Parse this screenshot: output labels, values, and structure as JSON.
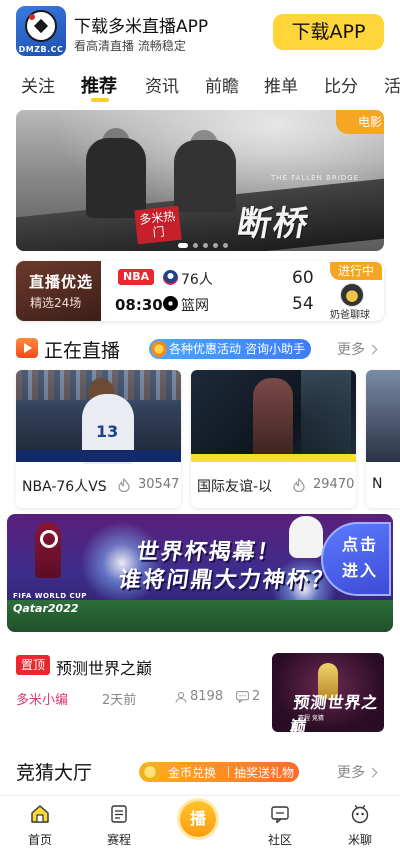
{
  "download_bar": {
    "logo_text": "DMZB.CC",
    "title": "下载多米直播APP",
    "subtitle": "看高清直播 流畅稳定",
    "button_label": "下载APP"
  },
  "tabs": [
    {
      "label": "关注"
    },
    {
      "label": "推荐"
    },
    {
      "label": "资讯"
    },
    {
      "label": "前瞻"
    },
    {
      "label": "推单"
    },
    {
      "label": "比分"
    },
    {
      "label": "活"
    }
  ],
  "hero": {
    "tag_label": "电影",
    "title_calligraphy": "断桥",
    "title_english": "THE FALLEN BRIDGE",
    "stamp_text": "多米热门",
    "slide_count": 5,
    "active_slide": 1
  },
  "match_card": {
    "pick_title": "直播优选",
    "pick_subtitle": "精选24场",
    "league": "NBA",
    "time": "08:30",
    "home_team": "76人",
    "away_team": "篮网",
    "home_score": "60",
    "away_score": "54",
    "status": "进行中",
    "anchor_name": "奶爸聊球"
  },
  "live_section": {
    "title": "正在直播",
    "promo_left": "各种优惠活动",
    "promo_right": "咨询小助手",
    "more_label": "更多"
  },
  "live_cards": [
    {
      "title": "NBA-76人VS",
      "heat": "30547",
      "jersey": "13"
    },
    {
      "title": "国际友谊-以",
      "heat": "29470"
    },
    {
      "title": "N",
      "heat": ""
    }
  ],
  "world_cup_banner": {
    "line1": "世界杯揭幕！",
    "line2": "谁将问鼎大力神杯？",
    "cup_name": "FIFA WORLD CUP",
    "cup_year": "Qatar2022",
    "cta": "点击进入"
  },
  "article": {
    "badge": "置顶",
    "title": "预测世界之巅",
    "author": "多米小编",
    "time": "2天前",
    "views": "8198",
    "comments": "2",
    "thumb_title": "预测世界之巅",
    "thumb_sub": "赛程  竞猜"
  },
  "contest_section": {
    "title": "竞猜大厅",
    "promo_left": "金币兑换",
    "promo_right": "抽奖送礼物",
    "more_label": "更多"
  },
  "bottom_nav": [
    {
      "label": "首页",
      "icon": "home-icon"
    },
    {
      "label": "赛程",
      "icon": "schedule-icon"
    },
    {
      "label": "播",
      "icon": "live-center-icon"
    },
    {
      "label": "社区",
      "icon": "community-icon"
    },
    {
      "label": "米聊",
      "icon": "chat-icon"
    }
  ],
  "colors": {
    "accent": "#ffd53a",
    "live_red": "#e8282f",
    "orange": "#f5a623",
    "author_pink": "#e0376e"
  }
}
